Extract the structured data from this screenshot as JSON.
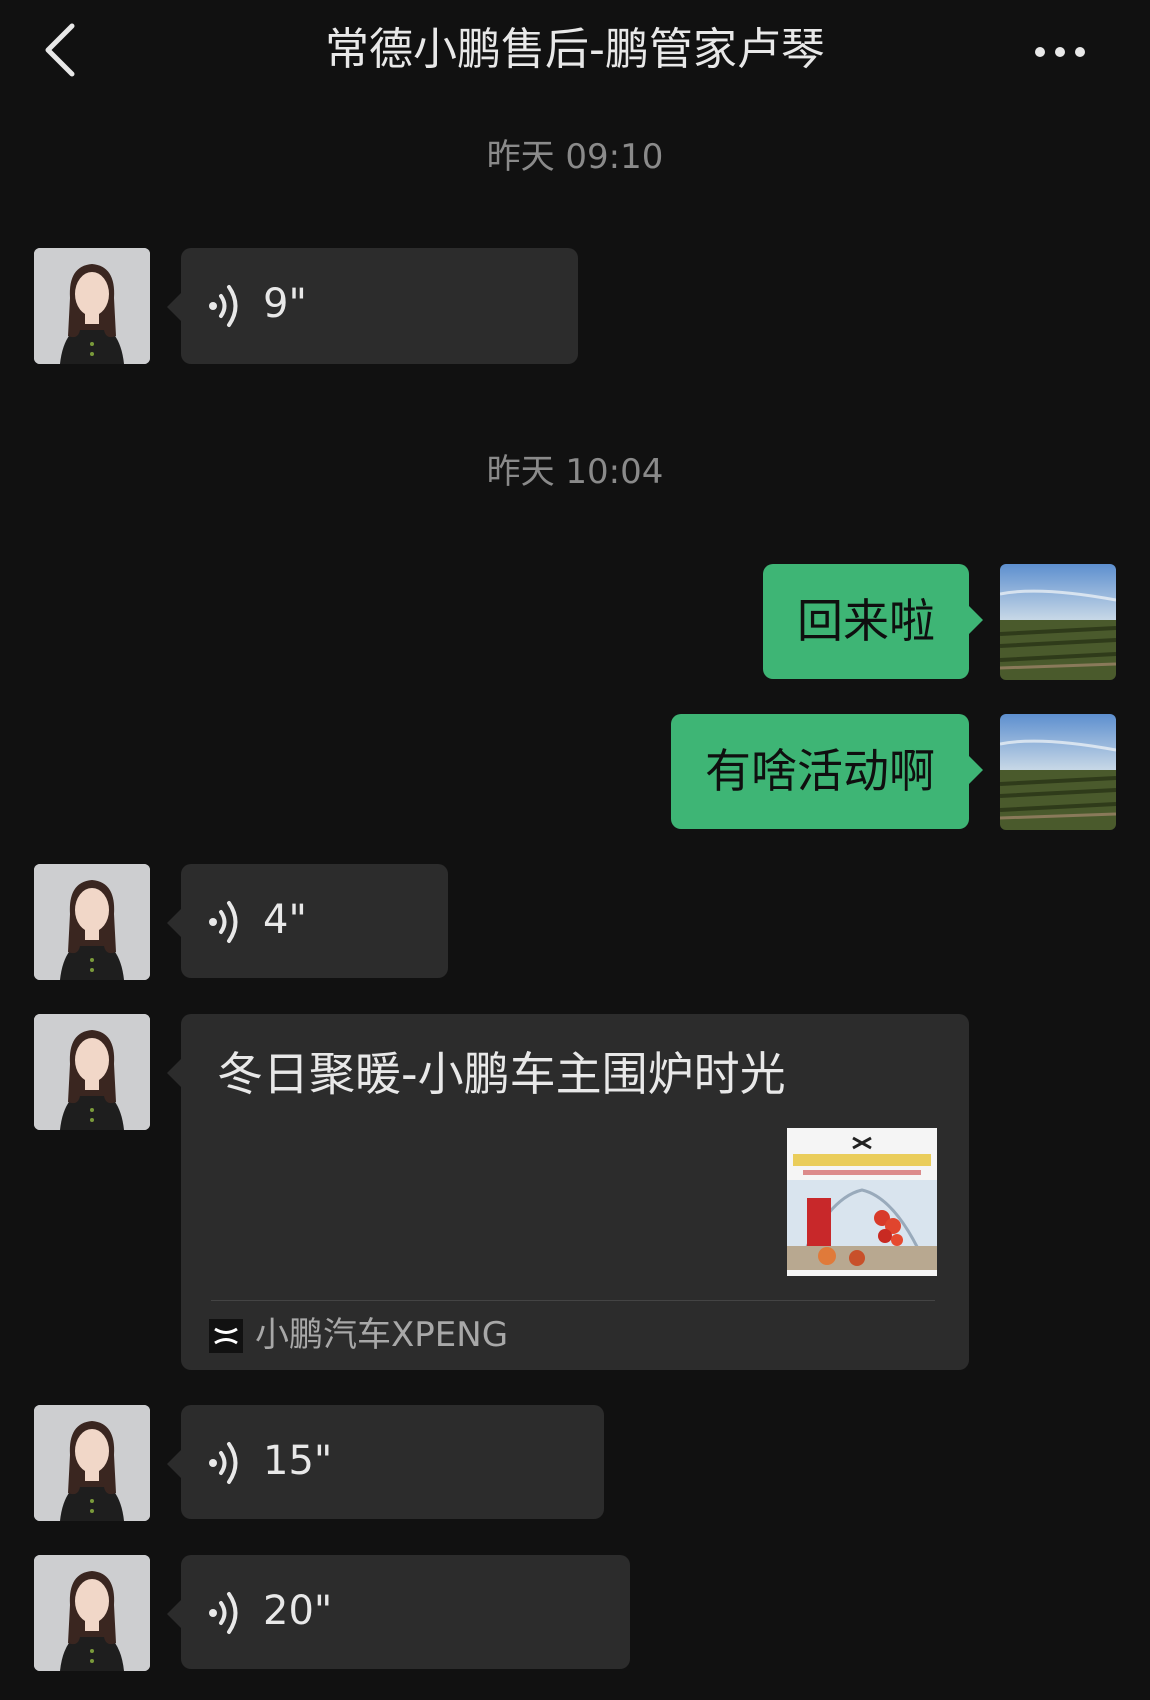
{
  "header": {
    "title": "常德小鹏售后-鹏管家卢琴",
    "back_icon": "chevron-left-icon",
    "more_icon": "more-horizontal-icon"
  },
  "timestamps": [
    "昨天 09:10",
    "昨天 10:04"
  ],
  "messages": [
    {
      "from": "them",
      "type": "voice",
      "duration": "9\""
    },
    {
      "from": "me",
      "type": "text",
      "text": "回来啦"
    },
    {
      "from": "me",
      "type": "text",
      "text": "有啥活动啊"
    },
    {
      "from": "them",
      "type": "voice",
      "duration": "4\""
    },
    {
      "from": "them",
      "type": "link",
      "title": "冬日聚暖-小鹏车主围炉时光",
      "source": "小鹏汽车XPENG"
    },
    {
      "from": "them",
      "type": "voice",
      "duration": "15\""
    },
    {
      "from": "them",
      "type": "voice",
      "duration": "20\""
    }
  ],
  "colors": {
    "background": "#111111",
    "bubble_received": "#2c2c2c",
    "bubble_sent": "#3eb575",
    "timestamp": "#8a8a8a"
  }
}
